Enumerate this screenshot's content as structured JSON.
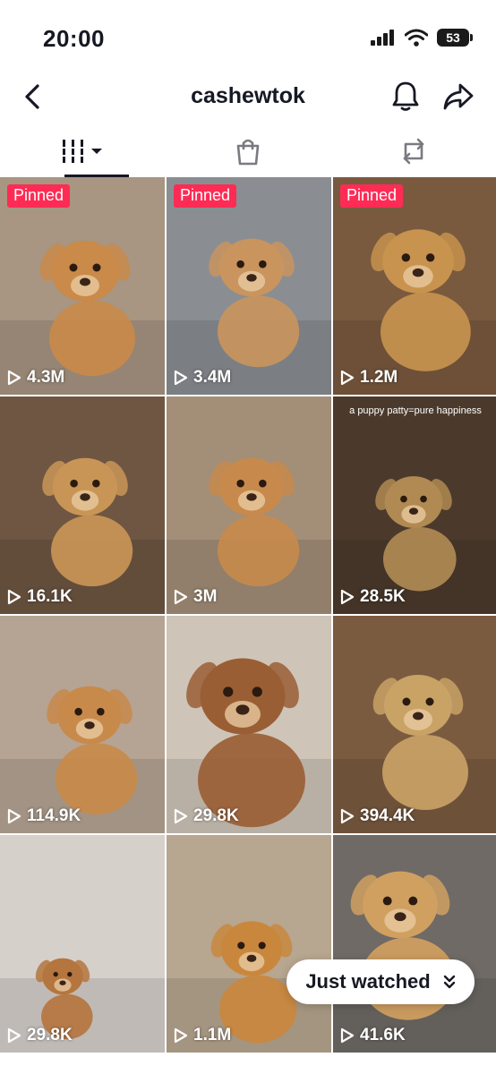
{
  "status": {
    "time": "20:00",
    "battery": "53"
  },
  "nav": {
    "title": "cashewtok"
  },
  "icons": {
    "back": "chevron-left-icon",
    "bell": "bell-icon",
    "share": "share-arrow-icon",
    "videos": "grid-icon",
    "shop": "shopping-bag-icon",
    "reposts": "repost-icon",
    "play": "play-icon"
  },
  "videos": [
    {
      "pinned": "Pinned",
      "views": "4.3M",
      "bg": "#a89582",
      "fur": "#c98a4a"
    },
    {
      "pinned": "Pinned",
      "views": "3.4M",
      "bg": "#8a8e92",
      "fur": "#c9945e"
    },
    {
      "pinned": "Pinned",
      "views": "1.2M",
      "bg": "#7a5a3e",
      "fur": "#c7934e"
    },
    {
      "views": "16.1K",
      "bg": "#6e5642",
      "fur": "#c99556"
    },
    {
      "views": "3M",
      "bg": "#a38e78",
      "fur": "#c78a4c"
    },
    {
      "caption": "a puppy patty=pure happiness",
      "views": "28.5K",
      "bg": "#4b3a2c",
      "fur": "#b08a52"
    },
    {
      "views": "114.9K",
      "bg": "#b5a493",
      "fur": "#c88a4a"
    },
    {
      "views": "29.8K",
      "bg": "#cfc4b8",
      "fur": "#9a5e35"
    },
    {
      "views": "394.4K",
      "bg": "#7b5b40",
      "fur": "#c9a266"
    },
    {
      "views": "29.8K",
      "bg": "#d6d0cb",
      "fur": "#b5753f"
    },
    {
      "views": "1.1M",
      "bg": "#b7a690",
      "fur": "#c9873e"
    },
    {
      "views": "41.6K",
      "bg": "#6f6a66",
      "fur": "#d0a060"
    }
  ],
  "just_watched": {
    "label": "Just watched"
  },
  "colors": {
    "pinned_badge": "#fe2c55",
    "text": "#161823"
  }
}
